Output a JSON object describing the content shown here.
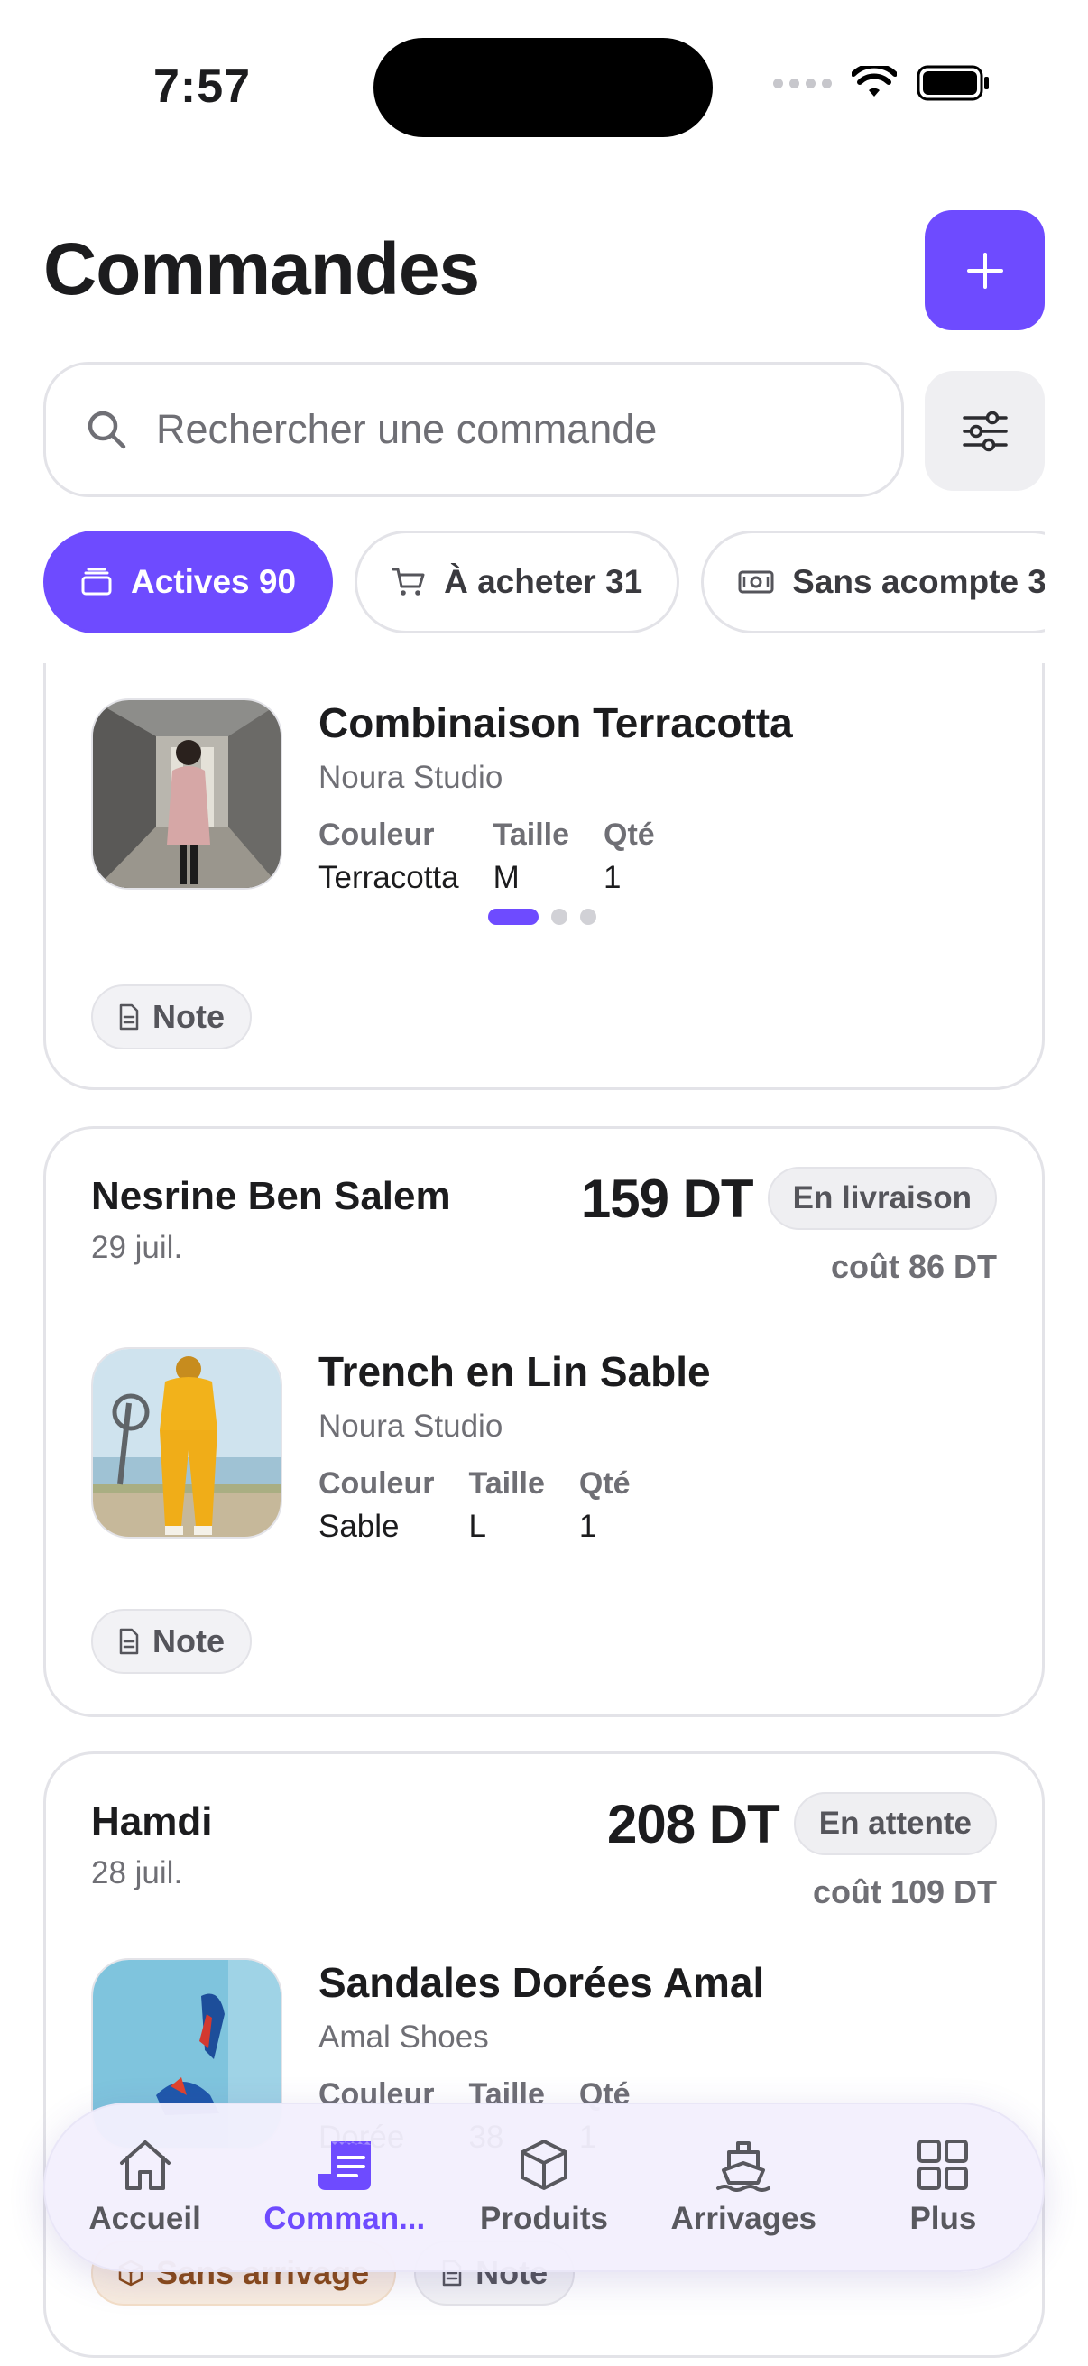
{
  "status_bar": {
    "time": "7:57"
  },
  "header": {
    "title": "Commandes",
    "add_icon": "plus-icon"
  },
  "search": {
    "placeholder": "Rechercher une commande",
    "icon": "search-icon",
    "filter_icon": "sliders-icon"
  },
  "chips": [
    {
      "label": "Actives 90",
      "icon": "stack-icon",
      "active": true
    },
    {
      "label": "À acheter 31",
      "icon": "cart-icon",
      "active": false
    },
    {
      "label": "Sans acompte 3",
      "icon": "cash-icon",
      "active": false
    }
  ],
  "spec_labels": {
    "color": "Couleur",
    "size": "Taille",
    "qty": "Qté"
  },
  "orders": [
    {
      "item": {
        "name": "Combinaison Terracotta",
        "brand": "Noura Studio",
        "color": "Terracotta",
        "size": "M",
        "qty": "1"
      },
      "carousel": {
        "pages": 3,
        "current": 1
      },
      "tags": [
        "Note"
      ]
    },
    {
      "customer": "Nesrine Ben Salem",
      "date": "29 juil.",
      "price": "159 DT",
      "status": "En livraison",
      "cost": "coût 86 DT",
      "item": {
        "name": "Trench en Lin Sable",
        "brand": "Noura Studio",
        "color": "Sable",
        "size": "L",
        "qty": "1"
      },
      "tags": [
        "Note"
      ]
    },
    {
      "customer": "Hamdi",
      "date": "28 juil.",
      "price": "208 DT",
      "status": "En attente",
      "cost": "coût 109 DT",
      "item": {
        "name": "Sandales Dorées Amal",
        "brand": "Amal Shoes",
        "color": "Dorée",
        "size": "38",
        "qty": "1"
      },
      "tags": [
        "Sans arrivage",
        "Note"
      ]
    }
  ],
  "tabbar": [
    {
      "label": "Accueil",
      "icon": "home-icon",
      "active": false
    },
    {
      "label": "Comman...",
      "icon": "receipt-icon",
      "active": true
    },
    {
      "label": "Produits",
      "icon": "box-icon",
      "active": false
    },
    {
      "label": "Arrivages",
      "icon": "ship-icon",
      "active": false
    },
    {
      "label": "Plus",
      "icon": "grid-icon",
      "active": false
    }
  ],
  "colors": {
    "accent": "#6e4bff",
    "warn_bg": "#f8ecdf",
    "warn_text": "#8a4a14"
  }
}
